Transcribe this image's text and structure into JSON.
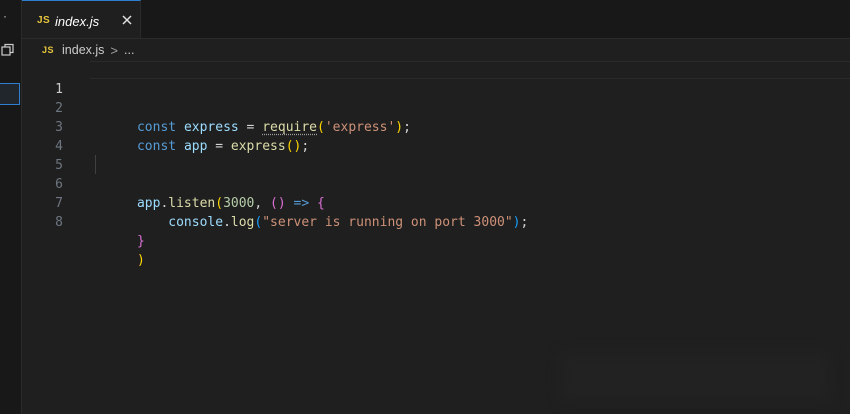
{
  "tab": {
    "badge": "JS",
    "filename": "index.js"
  },
  "breadcrumb": {
    "badge": "JS",
    "file": "index.js",
    "separator": ">",
    "rest": "..."
  },
  "lines": [
    {
      "num": "1"
    },
    {
      "num": "2"
    },
    {
      "num": "3"
    },
    {
      "num": "4"
    },
    {
      "num": "5"
    },
    {
      "num": "6"
    },
    {
      "num": "7"
    },
    {
      "num": "8"
    }
  ],
  "code": {
    "l1": {
      "kw": "const",
      "var": "express",
      "op": " = ",
      "fn": "require",
      "open": "(",
      "str": "'express'",
      "close": ")",
      "end": ";"
    },
    "l2": {
      "kw": "const",
      "var": "app",
      "op": " = ",
      "fn": "express",
      "parens": "()",
      "end": ";"
    },
    "l5": {
      "obj": "app",
      "dot": ".",
      "fn": "listen",
      "open": "(",
      "num": "3000",
      "comma": ", ",
      "parens": "()",
      "arrow": " => ",
      "brace": "{"
    },
    "l6": {
      "indent": "    ",
      "obj": "console",
      "dot": ".",
      "fn": "log",
      "open": "(",
      "str": "\"server is running on port 3000\"",
      "close": ")",
      "end": ";"
    },
    "l7": {
      "brace": "}"
    },
    "l8": {
      "close": ")"
    }
  },
  "colors": {
    "accent": "#2f7fd1",
    "js_badge": "#e6c53c",
    "editor_bg": "#1f1f1f"
  }
}
